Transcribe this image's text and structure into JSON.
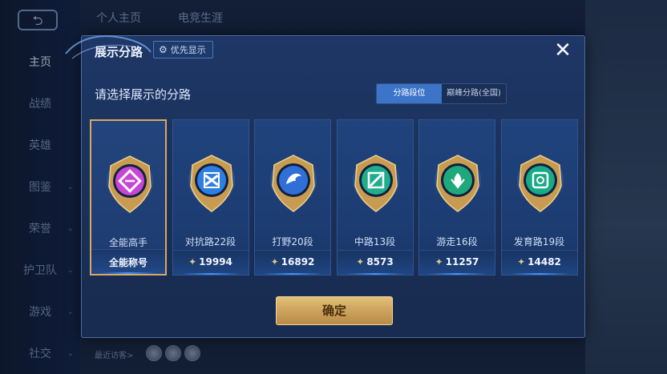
{
  "nav": {
    "back_label": "⮌",
    "items": [
      {
        "label": "主页",
        "active": true,
        "chevron": ""
      },
      {
        "label": "战绩",
        "active": false,
        "chevron": ""
      },
      {
        "label": "英雄",
        "active": false,
        "chevron": ""
      },
      {
        "label": "图鉴",
        "active": false,
        "chevron": "⌄"
      },
      {
        "label": "荣誉",
        "active": false,
        "chevron": "⌄"
      },
      {
        "label": "护卫队",
        "active": false,
        "chevron": "⌄"
      },
      {
        "label": "游戏",
        "active": false,
        "chevron": "⌄"
      },
      {
        "label": "社交",
        "active": false,
        "chevron": "⌄"
      }
    ]
  },
  "top_tabs": [
    "个人主页",
    "电竞生涯"
  ],
  "recent_visits_label": "最近访客>",
  "modal": {
    "title": "展示分路",
    "priority_label": "优先显示",
    "priority_icon": "gear-icon",
    "close_icon": "close-icon",
    "subtitle": "请选择展示的分路",
    "toggle": {
      "selected": "分路段位",
      "other": "巅峰分路(全国)"
    },
    "confirm_label": "确定",
    "cards": [
      {
        "name": "全能高手",
        "value": "全能称号",
        "selected": true,
        "color": "#c846d6",
        "icon": "all-round-icon",
        "show_level_icon": false
      },
      {
        "name": "对抗路22段",
        "value": "19994",
        "selected": false,
        "color": "#2f7fe0",
        "icon": "clash-lane-icon",
        "show_level_icon": true
      },
      {
        "name": "打野20段",
        "value": "16892",
        "selected": false,
        "color": "#2f6fd6",
        "icon": "jungle-icon",
        "show_level_icon": true
      },
      {
        "name": "中路13段",
        "value": "8573",
        "selected": false,
        "color": "#1fae8c",
        "icon": "mid-lane-icon",
        "show_level_icon": true
      },
      {
        "name": "游走16段",
        "value": "11257",
        "selected": false,
        "color": "#1fa87c",
        "icon": "roam-icon",
        "show_level_icon": true
      },
      {
        "name": "发育路19段",
        "value": "14482",
        "selected": false,
        "color": "#18a987",
        "icon": "farm-lane-icon",
        "show_level_icon": true
      }
    ]
  }
}
